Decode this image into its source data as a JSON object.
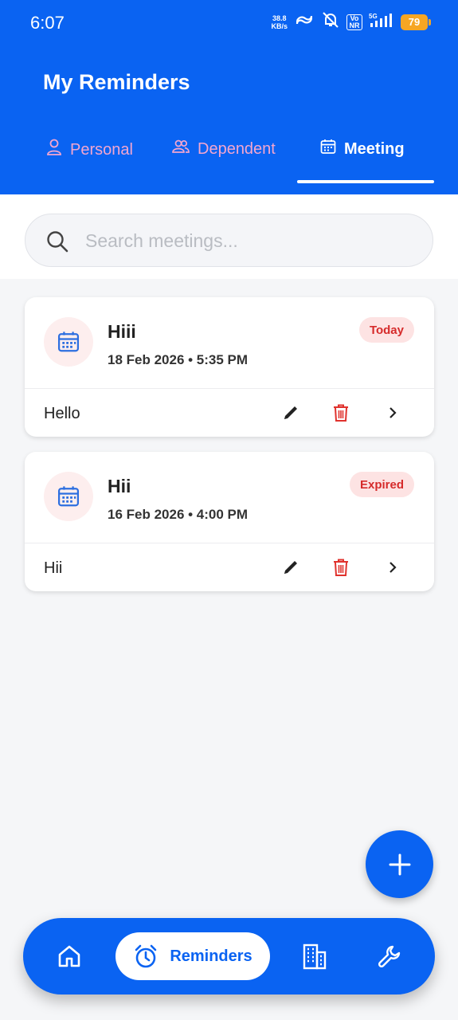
{
  "status_bar": {
    "time": "6:07",
    "net_speed_value": "38.8",
    "net_speed_unit": "KB/s",
    "volte": "Vo NR",
    "signal": "5G",
    "battery": "79"
  },
  "header": {
    "title": "My Reminders",
    "tabs": [
      {
        "label": "Personal",
        "icon": "person-icon",
        "active": false
      },
      {
        "label": "Dependent",
        "icon": "people-icon",
        "active": false
      },
      {
        "label": "Meeting",
        "icon": "calendar-icon",
        "active": true
      }
    ]
  },
  "search": {
    "placeholder": "Search meetings...",
    "value": ""
  },
  "meetings": [
    {
      "title": "Hiii",
      "datetime": "18 Feb 2026 • 5:35 PM",
      "status": "Today",
      "note": "Hello"
    },
    {
      "title": "Hii",
      "datetime": "16 Feb 2026 • 4:00 PM",
      "status": "Expired",
      "note": "Hii"
    }
  ],
  "bottom_nav": {
    "items": [
      {
        "icon": "home-icon"
      },
      {
        "icon": "alarm-clock-icon",
        "label": "Reminders",
        "active": true
      },
      {
        "icon": "buildings-icon"
      },
      {
        "icon": "wrench-icon"
      }
    ]
  },
  "colors": {
    "primary": "#0a63f2",
    "inactive_tab": "#f3a6cf",
    "badge_bg": "#fde3e3",
    "badge_text": "#d62b2b",
    "delete": "#e0322d",
    "background": "#f5f6f8"
  }
}
